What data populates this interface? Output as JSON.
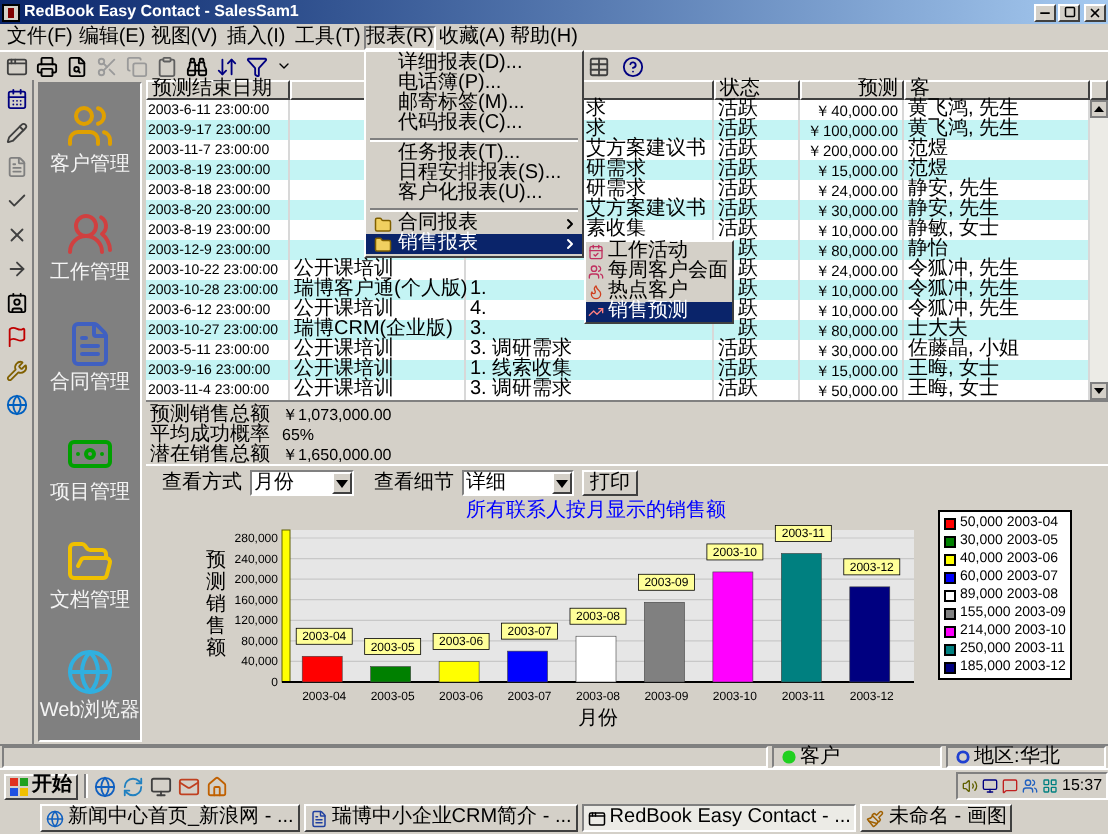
{
  "window": {
    "title": "RedBook Easy Contact - SalesSam1"
  },
  "menu_bar": [
    {
      "label": "文件(F)",
      "selected": false
    },
    {
      "label": "编辑(E)",
      "selected": false
    },
    {
      "label": "视图(V)",
      "selected": false
    },
    {
      "label": "插入(I)",
      "selected": false
    },
    {
      "label": "工具(T)",
      "selected": false
    },
    {
      "label": "报表(R)",
      "selected": true
    },
    {
      "label": "收藏(A)",
      "selected": false
    },
    {
      "label": "帮助(H)",
      "selected": false
    }
  ],
  "reports_menu": [
    {
      "kind": "item",
      "label": "详细报表(D)...",
      "selected": false
    },
    {
      "kind": "item",
      "label": "电话簿(P)...",
      "selected": false
    },
    {
      "kind": "item",
      "label": "邮寄标签(M)...",
      "selected": false
    },
    {
      "kind": "item",
      "label": "代码报表(C)...",
      "selected": false
    },
    {
      "kind": "separator"
    },
    {
      "kind": "item",
      "label": "任务报表(T)...",
      "selected": false
    },
    {
      "kind": "item",
      "label": "日程安排报表(S)...",
      "selected": false
    },
    {
      "kind": "item",
      "label": "客户化报表(U)...",
      "selected": false
    },
    {
      "kind": "separator"
    },
    {
      "kind": "submenu",
      "label": "合同报表",
      "selected": false
    },
    {
      "kind": "submenu",
      "label": "销售报表",
      "selected": true
    }
  ],
  "sales_submenu": [
    {
      "label": "工作活动",
      "selected": false
    },
    {
      "label": "每周客户会面",
      "selected": false
    },
    {
      "label": "热点客户",
      "selected": false
    },
    {
      "label": "销售预测",
      "selected": true
    }
  ],
  "nav": [
    {
      "label": "客户管理"
    },
    {
      "label": "工作管理"
    },
    {
      "label": "合同管理"
    },
    {
      "label": "项目管理"
    },
    {
      "label": "文档管理"
    },
    {
      "label": "Web浏览器"
    }
  ],
  "table": {
    "columns": {
      "date": "预测结束日期",
      "status": "状态",
      "forecast": "预测",
      "customer": "客"
    },
    "rows": [
      {
        "date": "2003-6-11 23:00:00",
        "stage": "求",
        "status": "活跃",
        "forecast": "￥40,000.00",
        "customer": "黄飞鸿, 先生"
      },
      {
        "date": "2003-9-17 23:00:00",
        "stage": "求",
        "status": "活跃",
        "forecast": "￥100,000.00",
        "customer": "黄飞鸿, 先生"
      },
      {
        "date": "2003-11-7 23:00:00",
        "stage": "艾方案建议书",
        "status": "活跃",
        "forecast": "￥200,000.00",
        "customer": "范煜"
      },
      {
        "date": "2003-8-19 23:00:00",
        "stage": "研需求",
        "status": "活跃",
        "forecast": "￥15,000.00",
        "customer": "范煜"
      },
      {
        "date": "2003-8-18 23:00:00",
        "stage": "研需求",
        "status": "活跃",
        "forecast": "￥24,000.00",
        "customer": "静安, 先生"
      },
      {
        "date": "2003-8-20 23:00:00",
        "stage": "艾方案建议书",
        "status": "活跃",
        "forecast": "￥30,000.00",
        "customer": "静安, 先生"
      },
      {
        "date": "2003-8-19 23:00:00",
        "stage": "素收集",
        "status": "活跃",
        "forecast": "￥10,000.00",
        "customer": "静敏, 女士"
      },
      {
        "date": "2003-12-9 23:00:00",
        "status": "跃",
        "forecast": "￥80,000.00",
        "customer": "静怡"
      },
      {
        "date": "2003-10-22 23:00:00",
        "product": "公开课培训",
        "status": "跃",
        "forecast": "￥24,000.00",
        "customer": "令狐冲, 先生"
      },
      {
        "date": "2003-10-28 23:00:00",
        "product": "瑞博客户通(个人版)",
        "stage": "1.",
        "status": "跃",
        "forecast": "￥10,000.00",
        "customer": "令狐冲, 先生"
      },
      {
        "date": "2003-6-12 23:00:00",
        "product": "公开课培训",
        "stage": "4.",
        "status": "跃",
        "forecast": "￥10,000.00",
        "customer": "令狐冲, 先生"
      },
      {
        "date": "2003-10-27 23:00:00",
        "product": "瑞博CRM(企业版)",
        "stage": "3.",
        "status": "跃",
        "forecast": "￥80,000.00",
        "customer": "士大夫"
      },
      {
        "date": "2003-5-11 23:00:00",
        "product": "公开课培训",
        "stage": "3. 调研需求",
        "status": "活跃",
        "forecast": "￥30,000.00",
        "customer": "佐藤晶, 小姐"
      },
      {
        "date": "2003-9-16 23:00:00",
        "product": "公开课培训",
        "stage": "1. 线索收集",
        "status": "活跃",
        "forecast": "￥15,000.00",
        "customer": "王晦, 女士"
      },
      {
        "date": "2003-11-4 23:00:00",
        "product": "公开课培训",
        "stage": "3. 调研需求",
        "status": "活跃",
        "forecast": "￥50,000.00",
        "customer": "王晦, 女士"
      }
    ]
  },
  "summary": [
    {
      "label": "预测销售总额",
      "value": "￥1,073,000.00"
    },
    {
      "label": "平均成功概率",
      "value": "65%"
    },
    {
      "label": "潜在销售总额",
      "value": "￥1,650,000.00"
    }
  ],
  "view_controls": {
    "view_by_label": "查看方式",
    "view_by": "月份",
    "detail_label": "查看细节",
    "detail": "详细",
    "print": "打印"
  },
  "chart": {
    "chart_data": {
      "type": "bar",
      "title": "所有联系人按月显示的销售额",
      "xlabel": "月份",
      "ylabel": "预测销售额",
      "categories": [
        "2003-04",
        "2003-05",
        "2003-06",
        "2003-07",
        "2003-08",
        "2003-09",
        "2003-10",
        "2003-11",
        "2003-12"
      ],
      "values": [
        50000,
        30000,
        40000,
        60000,
        89000,
        155000,
        214000,
        250000,
        185000
      ],
      "ylim": [
        0,
        280000
      ],
      "grid": true,
      "yticks": [
        {
          "value": 0,
          "label": "0"
        },
        {
          "value": 40000,
          "label": "40,000"
        },
        {
          "value": 80000,
          "label": "80,000"
        },
        {
          "value": 120000,
          "label": "120,000"
        },
        {
          "value": 160000,
          "label": "160,000"
        },
        {
          "value": 200000,
          "label": "200,000"
        },
        {
          "value": 240000,
          "label": "240,000"
        },
        {
          "value": 280000,
          "label": "280,000"
        }
      ],
      "annotations": [
        "2003-04",
        "2003-05",
        "2003-06",
        "2003-07",
        "2003-08",
        "2003-09",
        "2003-10",
        "2003-11",
        "2003-12"
      ]
    },
    "legend": [
      {
        "color": "#ff0000",
        "label": "50,000 2003-04"
      },
      {
        "color": "#008000",
        "label": "30,000 2003-05"
      },
      {
        "color": "#ffff00",
        "label": "40,000 2003-06"
      },
      {
        "color": "#0000ff",
        "label": "60,000 2003-07"
      },
      {
        "color": "#ffffff",
        "label": "89,000 2003-08"
      },
      {
        "color": "#808080",
        "label": "155,000 2003-09"
      },
      {
        "color": "#ff00ff",
        "label": "214,000 2003-10"
      },
      {
        "color": "#008080",
        "label": "250,000 2003-11"
      },
      {
        "color": "#000080",
        "label": "185,000 2003-12"
      }
    ]
  },
  "status_bar": {
    "record_type": "客户",
    "region": "地区:华北"
  },
  "taskbar": {
    "start": "开始",
    "tasks": [
      {
        "label": "新闻中心首页_新浪网 - ...",
        "selected": false
      },
      {
        "label": "瑞博中小企业CRM简介 - ...",
        "selected": false
      },
      {
        "label": "RedBook Easy Contact - ...",
        "selected": true
      },
      {
        "label": "未命名 - 画图",
        "selected": false
      }
    ],
    "clock": "15:37"
  }
}
